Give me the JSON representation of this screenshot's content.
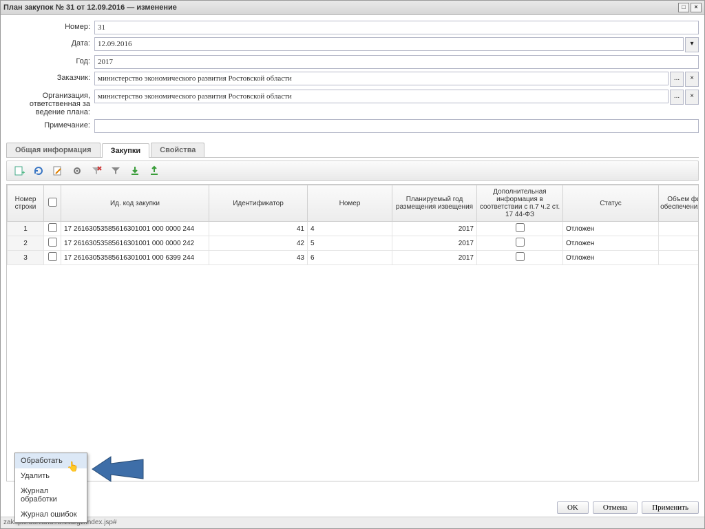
{
  "titlebar": {
    "title": "План закупок № 31 от 12.09.2016 — изменение"
  },
  "form": {
    "labels": {
      "number": "Номер:",
      "date": "Дата:",
      "year": "Год:",
      "customer": "Заказчик:",
      "org": "Организация, ответственная за ведение плана:",
      "note": "Примечание:"
    },
    "values": {
      "number": "31",
      "date": "12.09.2016",
      "year": "2017",
      "customer": "министерство экономического развития Ростовской области",
      "org": "министерство экономического развития Ростовской области",
      "note": ""
    }
  },
  "tabs": {
    "general": "Общая информация",
    "purchases": "Закупки",
    "props": "Свойства"
  },
  "grid": {
    "headers": {
      "rownum": "Номер строки",
      "idcode": "Ид. код закупки",
      "ident": "Идентификатор",
      "number": "Номер",
      "year": "Планируемый год размещения извещения",
      "extra": "Дополнительная информация в соответствии с п.7 ч.2 ст. 17 44-ФЗ",
      "status": "Статус",
      "volume": "Объем фина обеспечения: год"
    },
    "rows": [
      {
        "n": "1",
        "code": "17 26163053585616301001 000 0000 244",
        "ident": "41",
        "num": "4",
        "year": "2017",
        "status": "Отложен"
      },
      {
        "n": "2",
        "code": "17 26163053585616301001 000 0000 242",
        "ident": "42",
        "num": "5",
        "year": "2017",
        "status": "Отложен"
      },
      {
        "n": "3",
        "code": "17 26163053585616301001 000 6399 244",
        "ident": "43",
        "num": "6",
        "year": "2017",
        "status": "Отложен"
      }
    ]
  },
  "context_menu": {
    "process": "Обработать",
    "delete": "Удалить",
    "log_process": "Журнал обработки",
    "log_errors": "Журнал ошибок"
  },
  "footer": {
    "ok": "OK",
    "cancel": "Отмена",
    "apply": "Применить"
  },
  "statusbar": {
    "url": "zakupki.donland.ru:443/gz/index.jsp#"
  },
  "icons": {
    "ellipsis": "...",
    "clear": "×",
    "cal": "▾"
  }
}
